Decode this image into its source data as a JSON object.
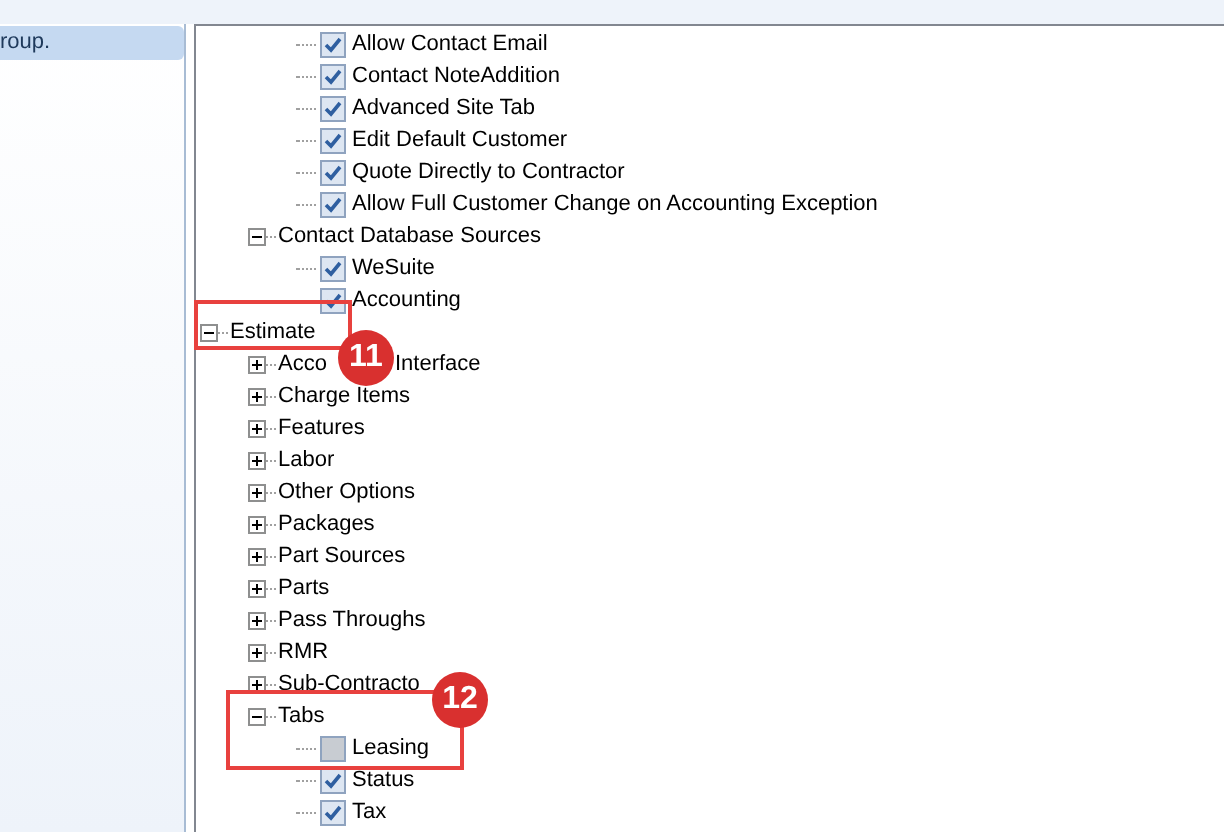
{
  "sidebar": {
    "items": [
      {
        "label": "roup.",
        "selected": true
      }
    ]
  },
  "tree": [
    {
      "children": [
        {
          "children": [
            {
              "label": "Allow Contact Email",
              "checked": true
            },
            {
              "label": "Contact NoteAddition",
              "checked": true
            },
            {
              "label": "Advanced Site Tab",
              "checked": true
            },
            {
              "label": "Edit Default Customer",
              "checked": true
            },
            {
              "label": "Quote Directly to Contractor",
              "checked": true
            },
            {
              "label": "Allow Full Customer Change on Accounting Exception",
              "checked": true
            }
          ]
        },
        {
          "label": "Contact Database Sources",
          "expanded": true,
          "children": [
            {
              "label": "WeSuite",
              "checked": true
            },
            {
              "label": "Accounting",
              "checked": true
            }
          ]
        }
      ]
    },
    {
      "label": "Estimate",
      "expanded": true,
      "children": [
        {
          "label_parts": [
            "Acco",
            "Interface"
          ],
          "expanded": false
        },
        {
          "label": "Charge Items",
          "expanded": false
        },
        {
          "label": "Features",
          "expanded": false
        },
        {
          "label": "Labor",
          "expanded": false
        },
        {
          "label": "Other Options",
          "expanded": false
        },
        {
          "label": "Packages",
          "expanded": false
        },
        {
          "label": "Part Sources",
          "expanded": false
        },
        {
          "label": "Parts",
          "expanded": false
        },
        {
          "label": "Pass Throughs",
          "expanded": false
        },
        {
          "label": "RMR",
          "expanded": false
        },
        {
          "label": "Sub-Contracto",
          "expanded": false
        },
        {
          "label": "Tabs",
          "expanded": true,
          "children": [
            {
              "label": "Leasing",
              "checked": false
            },
            {
              "label": "Status",
              "checked": true
            },
            {
              "label": "Tax",
              "checked": true
            }
          ]
        }
      ]
    }
  ],
  "annotations": [
    {
      "label": "11"
    },
    {
      "label": "12"
    }
  ]
}
